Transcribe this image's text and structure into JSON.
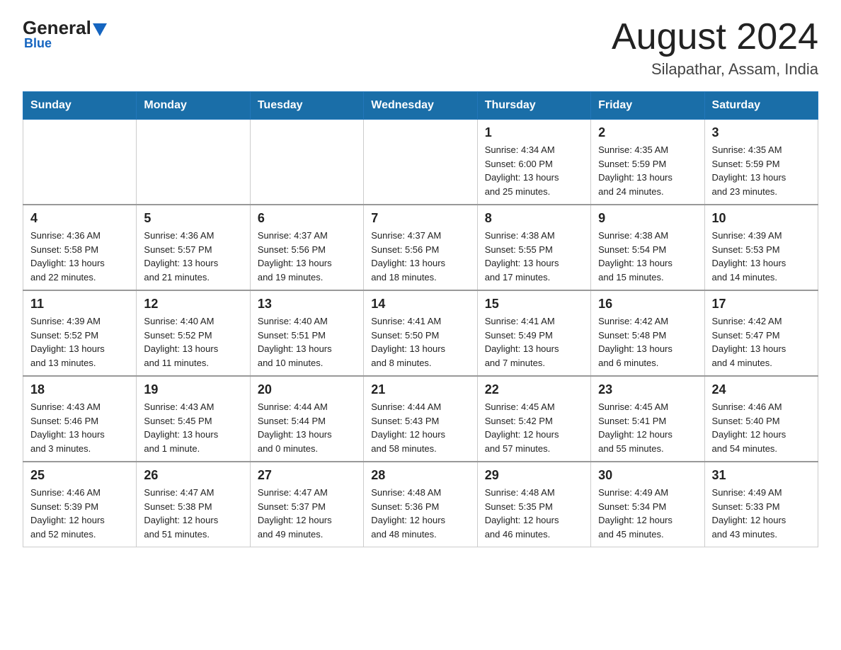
{
  "header": {
    "logo": {
      "general": "General",
      "triangle": "▲",
      "blue": "Blue"
    },
    "title": "August 2024",
    "location": "Silapathar, Assam, India"
  },
  "weekdays": [
    "Sunday",
    "Monday",
    "Tuesday",
    "Wednesday",
    "Thursday",
    "Friday",
    "Saturday"
  ],
  "weeks": [
    [
      {
        "day": "",
        "info": ""
      },
      {
        "day": "",
        "info": ""
      },
      {
        "day": "",
        "info": ""
      },
      {
        "day": "",
        "info": ""
      },
      {
        "day": "1",
        "info": "Sunrise: 4:34 AM\nSunset: 6:00 PM\nDaylight: 13 hours\nand 25 minutes."
      },
      {
        "day": "2",
        "info": "Sunrise: 4:35 AM\nSunset: 5:59 PM\nDaylight: 13 hours\nand 24 minutes."
      },
      {
        "day": "3",
        "info": "Sunrise: 4:35 AM\nSunset: 5:59 PM\nDaylight: 13 hours\nand 23 minutes."
      }
    ],
    [
      {
        "day": "4",
        "info": "Sunrise: 4:36 AM\nSunset: 5:58 PM\nDaylight: 13 hours\nand 22 minutes."
      },
      {
        "day": "5",
        "info": "Sunrise: 4:36 AM\nSunset: 5:57 PM\nDaylight: 13 hours\nand 21 minutes."
      },
      {
        "day": "6",
        "info": "Sunrise: 4:37 AM\nSunset: 5:56 PM\nDaylight: 13 hours\nand 19 minutes."
      },
      {
        "day": "7",
        "info": "Sunrise: 4:37 AM\nSunset: 5:56 PM\nDaylight: 13 hours\nand 18 minutes."
      },
      {
        "day": "8",
        "info": "Sunrise: 4:38 AM\nSunset: 5:55 PM\nDaylight: 13 hours\nand 17 minutes."
      },
      {
        "day": "9",
        "info": "Sunrise: 4:38 AM\nSunset: 5:54 PM\nDaylight: 13 hours\nand 15 minutes."
      },
      {
        "day": "10",
        "info": "Sunrise: 4:39 AM\nSunset: 5:53 PM\nDaylight: 13 hours\nand 14 minutes."
      }
    ],
    [
      {
        "day": "11",
        "info": "Sunrise: 4:39 AM\nSunset: 5:52 PM\nDaylight: 13 hours\nand 13 minutes."
      },
      {
        "day": "12",
        "info": "Sunrise: 4:40 AM\nSunset: 5:52 PM\nDaylight: 13 hours\nand 11 minutes."
      },
      {
        "day": "13",
        "info": "Sunrise: 4:40 AM\nSunset: 5:51 PM\nDaylight: 13 hours\nand 10 minutes."
      },
      {
        "day": "14",
        "info": "Sunrise: 4:41 AM\nSunset: 5:50 PM\nDaylight: 13 hours\nand 8 minutes."
      },
      {
        "day": "15",
        "info": "Sunrise: 4:41 AM\nSunset: 5:49 PM\nDaylight: 13 hours\nand 7 minutes."
      },
      {
        "day": "16",
        "info": "Sunrise: 4:42 AM\nSunset: 5:48 PM\nDaylight: 13 hours\nand 6 minutes."
      },
      {
        "day": "17",
        "info": "Sunrise: 4:42 AM\nSunset: 5:47 PM\nDaylight: 13 hours\nand 4 minutes."
      }
    ],
    [
      {
        "day": "18",
        "info": "Sunrise: 4:43 AM\nSunset: 5:46 PM\nDaylight: 13 hours\nand 3 minutes."
      },
      {
        "day": "19",
        "info": "Sunrise: 4:43 AM\nSunset: 5:45 PM\nDaylight: 13 hours\nand 1 minute."
      },
      {
        "day": "20",
        "info": "Sunrise: 4:44 AM\nSunset: 5:44 PM\nDaylight: 13 hours\nand 0 minutes."
      },
      {
        "day": "21",
        "info": "Sunrise: 4:44 AM\nSunset: 5:43 PM\nDaylight: 12 hours\nand 58 minutes."
      },
      {
        "day": "22",
        "info": "Sunrise: 4:45 AM\nSunset: 5:42 PM\nDaylight: 12 hours\nand 57 minutes."
      },
      {
        "day": "23",
        "info": "Sunrise: 4:45 AM\nSunset: 5:41 PM\nDaylight: 12 hours\nand 55 minutes."
      },
      {
        "day": "24",
        "info": "Sunrise: 4:46 AM\nSunset: 5:40 PM\nDaylight: 12 hours\nand 54 minutes."
      }
    ],
    [
      {
        "day": "25",
        "info": "Sunrise: 4:46 AM\nSunset: 5:39 PM\nDaylight: 12 hours\nand 52 minutes."
      },
      {
        "day": "26",
        "info": "Sunrise: 4:47 AM\nSunset: 5:38 PM\nDaylight: 12 hours\nand 51 minutes."
      },
      {
        "day": "27",
        "info": "Sunrise: 4:47 AM\nSunset: 5:37 PM\nDaylight: 12 hours\nand 49 minutes."
      },
      {
        "day": "28",
        "info": "Sunrise: 4:48 AM\nSunset: 5:36 PM\nDaylight: 12 hours\nand 48 minutes."
      },
      {
        "day": "29",
        "info": "Sunrise: 4:48 AM\nSunset: 5:35 PM\nDaylight: 12 hours\nand 46 minutes."
      },
      {
        "day": "30",
        "info": "Sunrise: 4:49 AM\nSunset: 5:34 PM\nDaylight: 12 hours\nand 45 minutes."
      },
      {
        "day": "31",
        "info": "Sunrise: 4:49 AM\nSunset: 5:33 PM\nDaylight: 12 hours\nand 43 minutes."
      }
    ]
  ]
}
